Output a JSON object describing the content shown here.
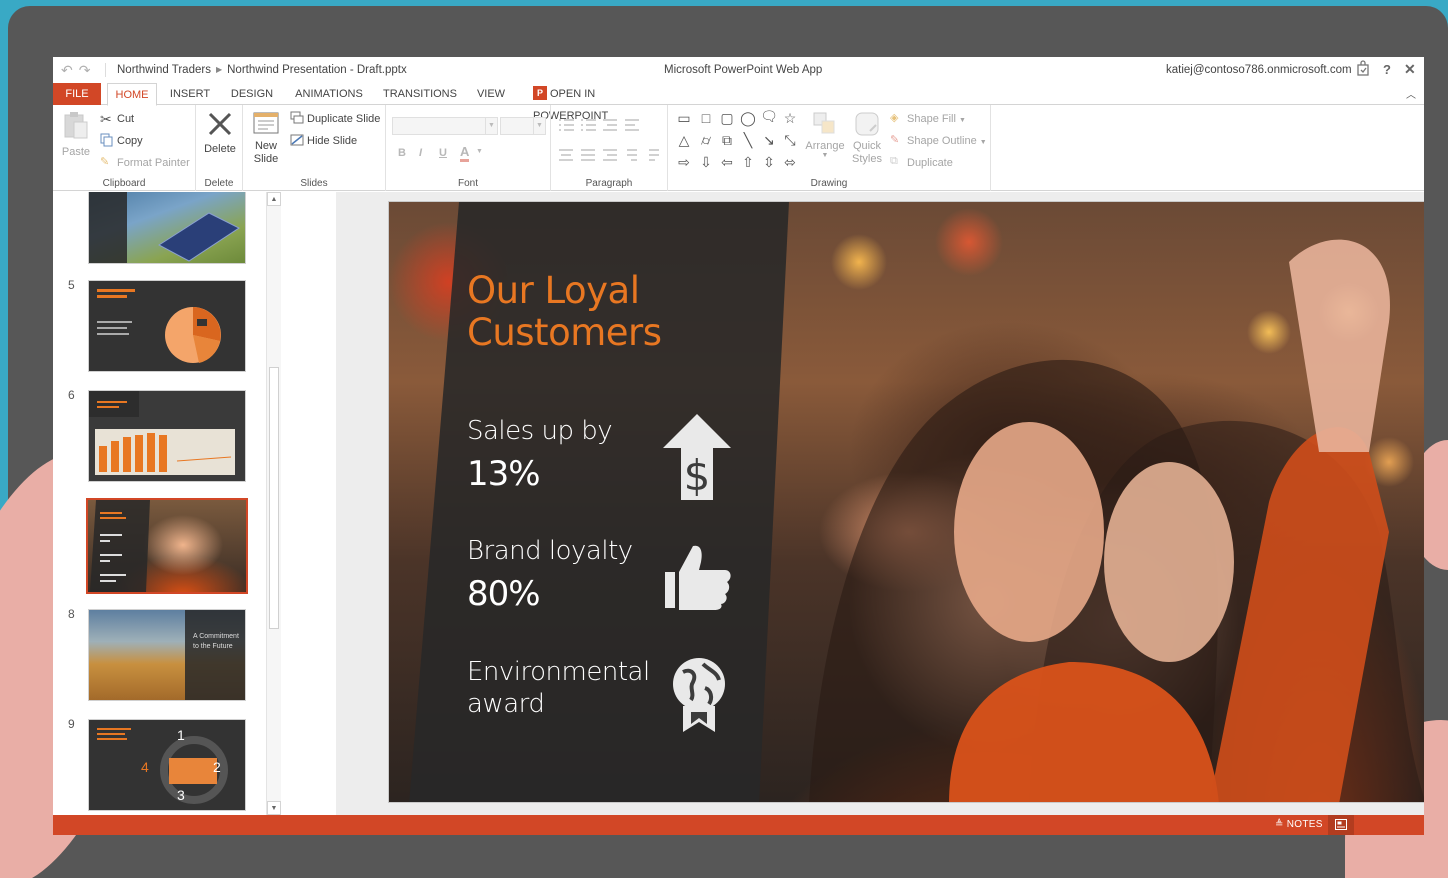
{
  "titlebar": {
    "breadcrumb_site": "Northwind Traders",
    "breadcrumb_file": "Northwind Presentation - Draft.pptx",
    "app_title": "Microsoft PowerPoint Web App",
    "user": "katiej@contoso786.onmicrosoft.com",
    "help": "?",
    "close": "✕"
  },
  "tabs": [
    "FILE",
    "HOME",
    "INSERT",
    "DESIGN",
    "ANIMATIONS",
    "TRANSITIONS",
    "VIEW"
  ],
  "open_in": "OPEN IN POWERPOINT",
  "open_in_badge": "P",
  "ribbon": {
    "clipboard": {
      "paste": "Paste",
      "cut": "Cut",
      "copy": "Copy",
      "format_painter": "Format Painter",
      "label": "Clipboard"
    },
    "delete": {
      "delete": "Delete",
      "label": "Delete"
    },
    "slides": {
      "new_slide_1": "New",
      "new_slide_2": "Slide",
      "duplicate": "Duplicate Slide",
      "hide": "Hide Slide",
      "label": "Slides"
    },
    "font": {
      "bold": "B",
      "italic": "I",
      "underline": "U",
      "color": "A",
      "label": "Font"
    },
    "paragraph": {
      "label": "Paragraph"
    },
    "drawing": {
      "arrange": "Arrange",
      "quick_1": "Quick",
      "quick_2": "Styles",
      "shape_fill": "Shape Fill",
      "shape_outline": "Shape Outline",
      "duplicate": "Duplicate",
      "label": "Drawing"
    }
  },
  "thumbnails": [
    {
      "num": "5"
    },
    {
      "num": "6"
    },
    {
      "num": "8",
      "text": "A Commitment to the Future"
    },
    {
      "num": "9"
    }
  ],
  "slide": {
    "title_line1": "Our Loyal",
    "title_line2": "Customers",
    "stat1_label": "Sales up by",
    "stat1_value": "13%",
    "stat2_label": "Brand loyalty",
    "stat2_value": "80%",
    "stat3_label_1": "Environmental",
    "stat3_label_2": "award",
    "accent": "#e87722"
  },
  "statusbar": {
    "notes": "NOTES"
  },
  "colors": {
    "brand": "#d24726",
    "background": "#39a9c5",
    "device": "#575757"
  }
}
